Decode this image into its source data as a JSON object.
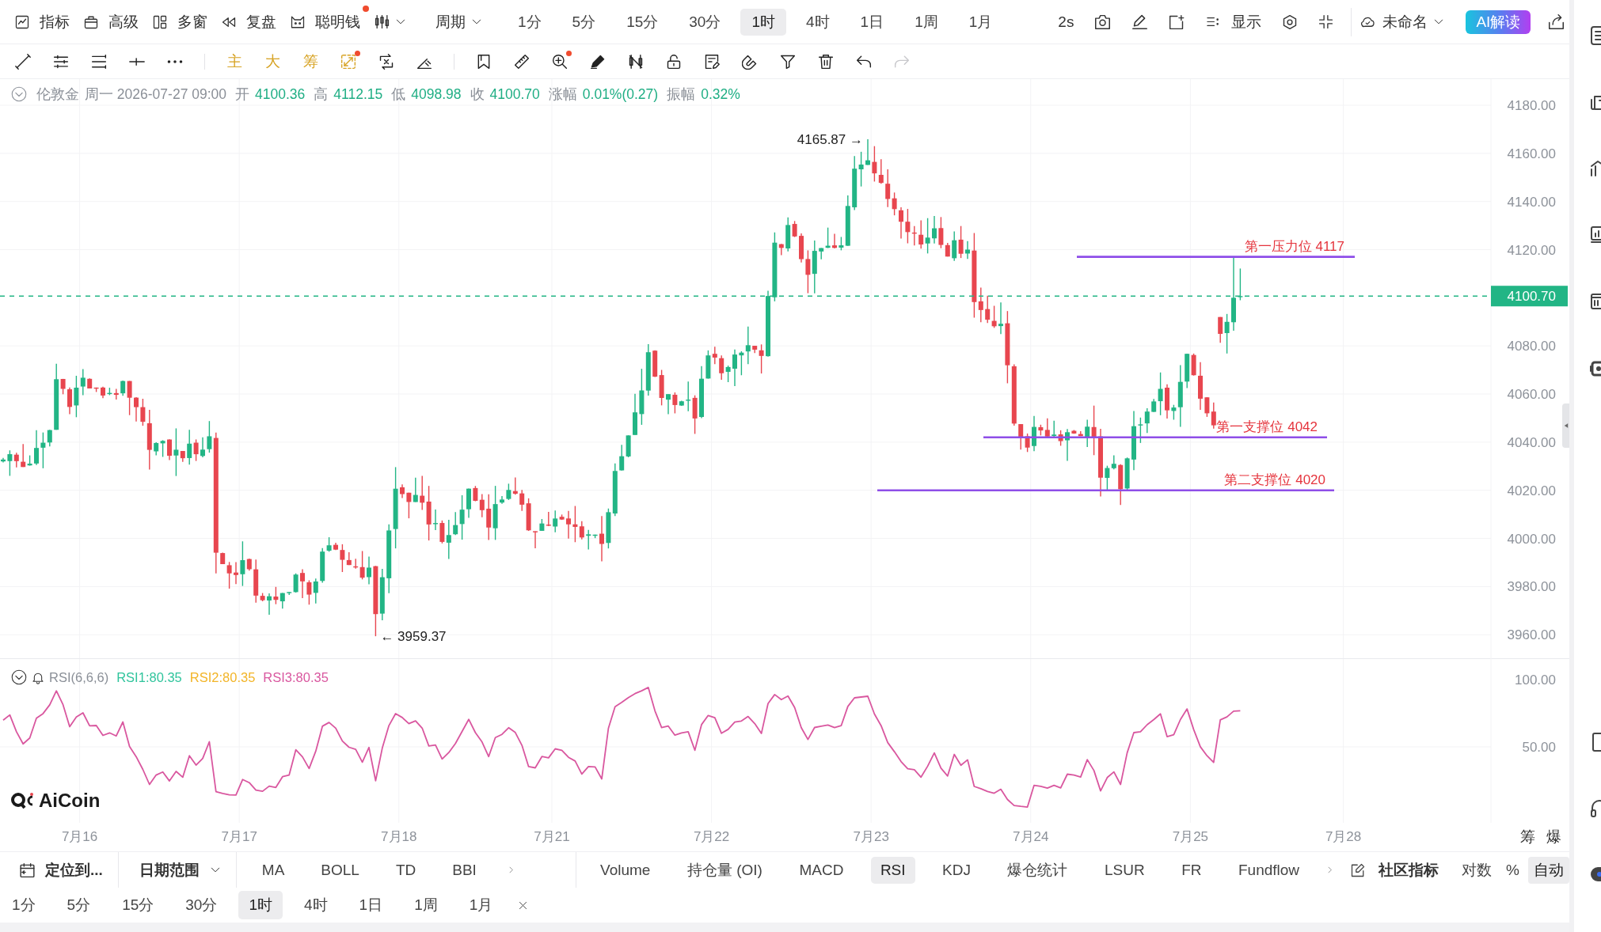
{
  "top_toolbar": {
    "tools": [
      {
        "label": "指标",
        "dot": false
      },
      {
        "label": "高级",
        "dot": false
      },
      {
        "label": "多窗",
        "dot": false
      },
      {
        "label": "复盘",
        "dot": false
      },
      {
        "label": "聪明钱",
        "dot": true
      }
    ],
    "period_menu": "周期",
    "periods": [
      {
        "label": "1分",
        "selected": false
      },
      {
        "label": "5分",
        "selected": false
      },
      {
        "label": "15分",
        "selected": false
      },
      {
        "label": "30分",
        "selected": false
      },
      {
        "label": "1时",
        "selected": true
      },
      {
        "label": "4时",
        "selected": false
      },
      {
        "label": "1日",
        "selected": false
      },
      {
        "label": "1周",
        "selected": false
      },
      {
        "label": "1月",
        "selected": false
      }
    ],
    "refresh_interval": "2s",
    "display": "显示",
    "layout_name": "未命名",
    "ai_button": "AI解读"
  },
  "drawing_toolbar": {
    "items": [
      {
        "kind": "icon",
        "dot": false,
        "disabled": false
      },
      {
        "kind": "icon",
        "dot": false,
        "disabled": false
      },
      {
        "kind": "icon",
        "dot": false,
        "disabled": false
      },
      {
        "kind": "icon",
        "dot": false,
        "disabled": false
      },
      {
        "kind": "icon",
        "dot": false,
        "disabled": false
      },
      {
        "kind": "text",
        "label": "主",
        "dot": false,
        "disabled": false
      },
      {
        "kind": "text",
        "label": "大",
        "dot": false,
        "disabled": false
      },
      {
        "kind": "text",
        "label": "筹",
        "dot": false,
        "disabled": false
      },
      {
        "kind": "icon",
        "dot": true,
        "disabled": false
      },
      {
        "kind": "icon",
        "dot": false,
        "disabled": false
      },
      {
        "kind": "icon",
        "dot": false,
        "disabled": false
      },
      {
        "kind": "icon",
        "dot": false,
        "disabled": false
      },
      {
        "kind": "icon",
        "dot": false,
        "disabled": false
      },
      {
        "kind": "icon",
        "dot": true,
        "disabled": false
      },
      {
        "kind": "icon",
        "dot": false,
        "disabled": false
      },
      {
        "kind": "icon",
        "dot": false,
        "disabled": false
      },
      {
        "kind": "icon",
        "dot": false,
        "disabled": false
      },
      {
        "kind": "icon",
        "dot": false,
        "disabled": false
      },
      {
        "kind": "icon",
        "dot": false,
        "disabled": false
      },
      {
        "kind": "icon",
        "dot": false,
        "disabled": false
      },
      {
        "kind": "icon",
        "dot": false,
        "disabled": false
      },
      {
        "kind": "icon",
        "dot": false,
        "disabled": false
      },
      {
        "kind": "icon",
        "dot": false,
        "disabled": true
      }
    ]
  },
  "info_bar": {
    "symbol": "伦敦金",
    "time": "周一 2026-07-27 09:00",
    "fields": [
      {
        "label": "开",
        "value": "4100.36"
      },
      {
        "label": "高",
        "value": "4112.15"
      },
      {
        "label": "低",
        "value": "4098.98"
      },
      {
        "label": "收",
        "value": "4100.70"
      },
      {
        "label": "涨幅",
        "value": "0.01%(0.27)"
      },
      {
        "label": "振幅",
        "value": "0.32%"
      }
    ]
  },
  "price_chart": {
    "y_axis": [
      "4180.00",
      "4160.00",
      "4140.00",
      "4120.00",
      "4080.00",
      "4060.00",
      "4040.00",
      "4020.00",
      "4000.00",
      "3980.00",
      "3960.00"
    ],
    "last_price": "4100.70",
    "high_marker": "4165.87 →",
    "low_marker": "← 3959.37",
    "levels": [
      {
        "label": "第一压力位 4117"
      },
      {
        "label": "第一支撑位 4042"
      },
      {
        "label": "第二支撑位 4020"
      }
    ]
  },
  "rsi_panel": {
    "title": "RSI(6,6,6)",
    "series": [
      {
        "label": "RSI1:80.35",
        "color": "#2fc49c"
      },
      {
        "label": "RSI2:80.35",
        "color": "#f2b427"
      },
      {
        "label": "RSI3:80.35",
        "color": "#d9579f"
      }
    ],
    "y_axis": [
      "100.00",
      "50.00"
    ],
    "logo": "AiCoin"
  },
  "x_axis": {
    "labels": [
      "7月16",
      "7月17",
      "7月18",
      "7月21",
      "7月22",
      "7月23",
      "7月24",
      "7月25",
      "7月28"
    ],
    "buttons": [
      "筹",
      "爆"
    ]
  },
  "bottom_toolbar": {
    "locate": "定位到...",
    "date_range": "日期范围",
    "main_indicators": [
      "MA",
      "BOLL",
      "TD",
      "BBI"
    ],
    "sub_indicators": [
      {
        "label": "Volume",
        "selected": false
      },
      {
        "label": "持仓量 (OI)",
        "selected": false
      },
      {
        "label": "MACD",
        "selected": false
      },
      {
        "label": "RSI",
        "selected": true
      },
      {
        "label": "KDJ",
        "selected": false
      },
      {
        "label": "爆仓统计",
        "selected": false
      },
      {
        "label": "LSUR",
        "selected": false
      },
      {
        "label": "FR",
        "selected": false
      },
      {
        "label": "Fundflow",
        "selected": false
      }
    ],
    "community": "社区指标",
    "scale_options": [
      {
        "label": "对数",
        "selected": false
      },
      {
        "label": "%",
        "selected": false
      },
      {
        "label": "自动",
        "selected": true
      }
    ]
  },
  "quick_periods": [
    {
      "label": "1分",
      "selected": false
    },
    {
      "label": "5分",
      "selected": false
    },
    {
      "label": "15分",
      "selected": false
    },
    {
      "label": "30分",
      "selected": false
    },
    {
      "label": "1时",
      "selected": true
    },
    {
      "label": "4时",
      "selected": false
    },
    {
      "label": "1日",
      "selected": false
    },
    {
      "label": "1周",
      "selected": false
    },
    {
      "label": "1月",
      "selected": false
    }
  ]
}
